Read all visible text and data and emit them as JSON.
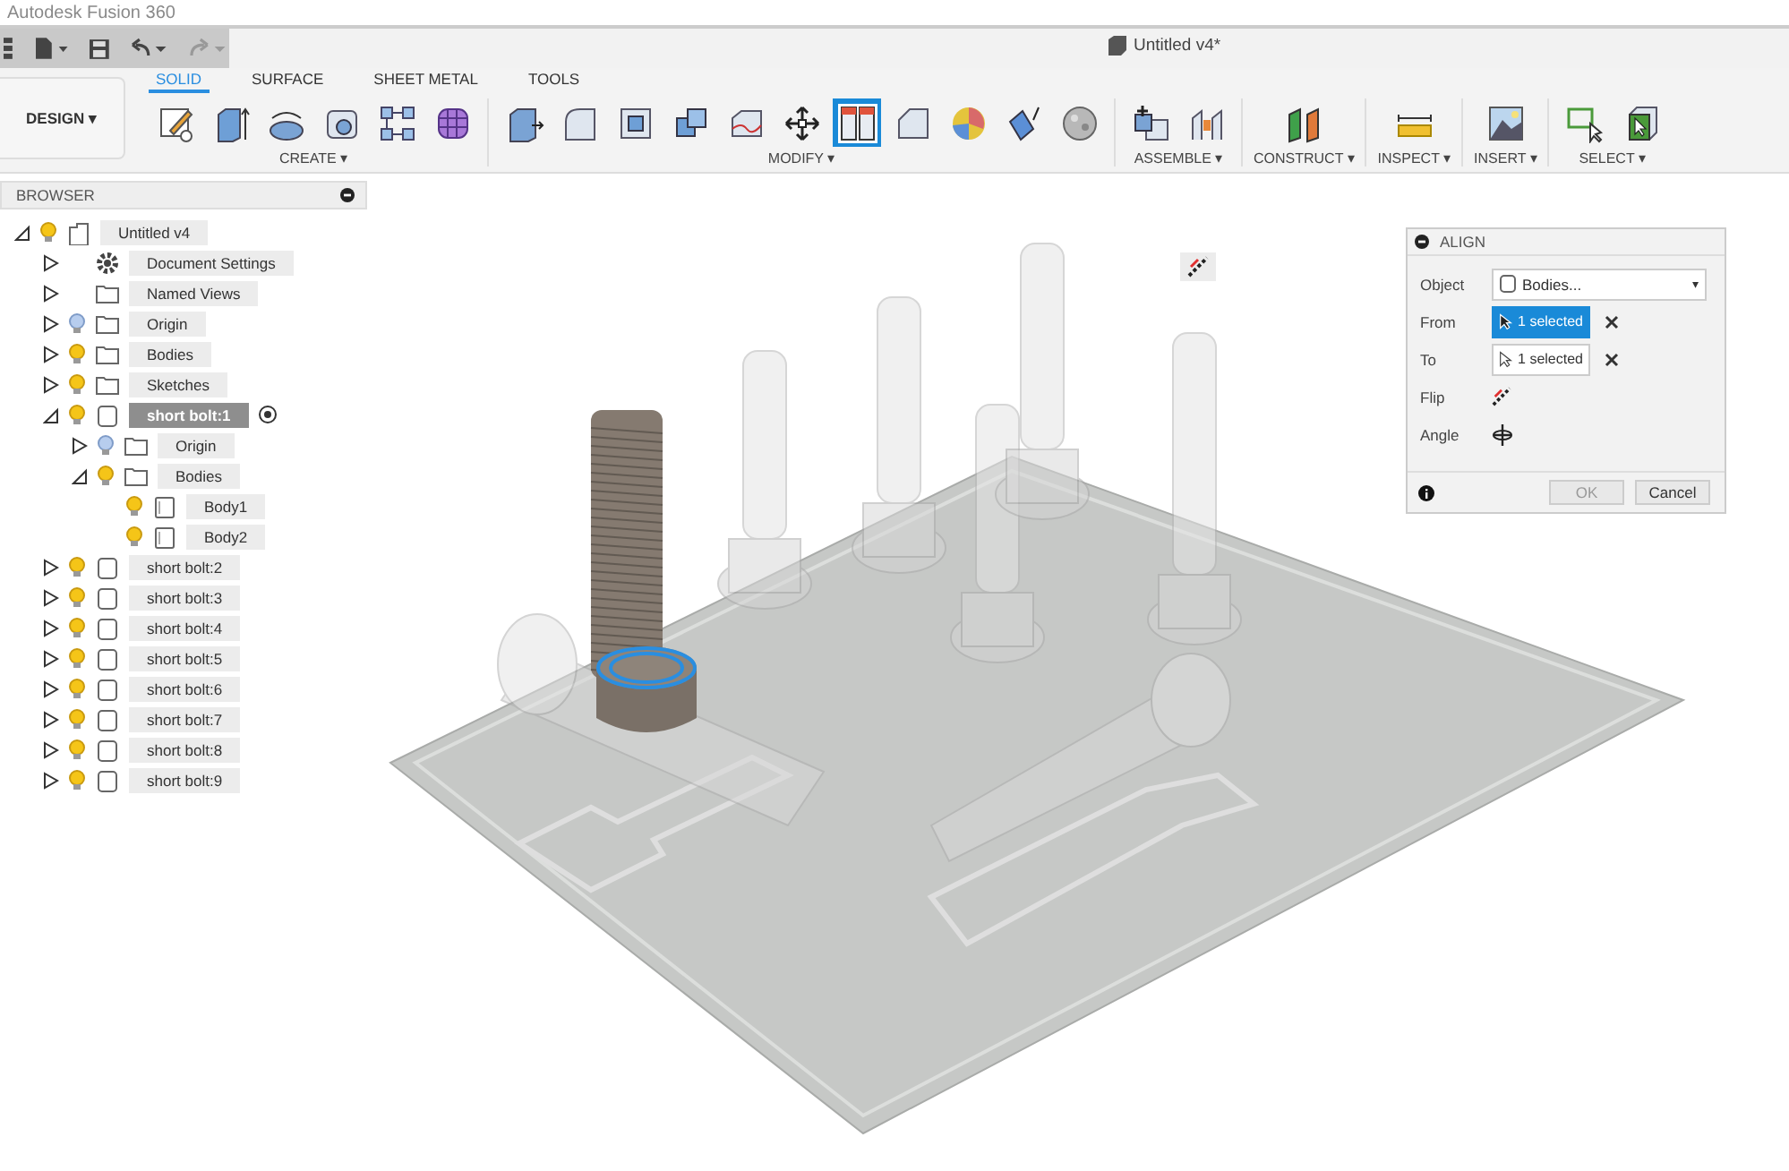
{
  "app_title": "Autodesk Fusion 360",
  "document_tab": {
    "title": "Untitled v4*"
  },
  "workspace": {
    "label": "DESIGN",
    "caret": "▾"
  },
  "tabs": [
    {
      "label": "SOLID",
      "selected": true
    },
    {
      "label": "SURFACE",
      "selected": false
    },
    {
      "label": "SHEET METAL",
      "selected": false
    },
    {
      "label": "TOOLS",
      "selected": false
    }
  ],
  "groups": [
    {
      "label": "CREATE ▾",
      "tools": [
        {
          "kind": "sketch",
          "active": false
        },
        {
          "kind": "extrude",
          "active": false
        },
        {
          "kind": "revolve",
          "active": false
        },
        {
          "kind": "hole",
          "active": false
        },
        {
          "kind": "pattern",
          "active": false
        },
        {
          "kind": "form",
          "active": false
        }
      ]
    },
    {
      "label": "MODIFY ▾",
      "tools": [
        {
          "kind": "press",
          "active": false
        },
        {
          "kind": "fillet",
          "active": false
        },
        {
          "kind": "shell",
          "active": false
        },
        {
          "kind": "combine",
          "active": false
        },
        {
          "kind": "replace",
          "active": false
        },
        {
          "kind": "move",
          "active": false
        },
        {
          "kind": "align",
          "active": true
        },
        {
          "kind": "chamfer",
          "active": false
        },
        {
          "kind": "appearance",
          "active": false
        },
        {
          "kind": "draft",
          "active": false
        },
        {
          "kind": "material",
          "active": false
        }
      ]
    },
    {
      "label": "ASSEMBLE ▾",
      "tools": [
        {
          "kind": "component",
          "active": false
        },
        {
          "kind": "joint",
          "active": false
        }
      ]
    },
    {
      "label": "CONSTRUCT ▾",
      "tools": [
        {
          "kind": "plane",
          "active": false
        }
      ]
    },
    {
      "label": "INSPECT ▾",
      "tools": [
        {
          "kind": "measure",
          "active": false
        }
      ]
    },
    {
      "label": "INSERT ▾",
      "tools": [
        {
          "kind": "image",
          "active": false
        }
      ]
    },
    {
      "label": "SELECT ▾",
      "tools": [
        {
          "kind": "window",
          "active": false
        },
        {
          "kind": "select",
          "active": false
        }
      ]
    }
  ],
  "browser": {
    "title": "BROWSER"
  },
  "tree": [
    {
      "label": "Untitled v4",
      "kind": "document",
      "visible": true,
      "expanded": true,
      "selected": false,
      "children": [
        {
          "label": "Document Settings",
          "kind": "settings",
          "expanded": false,
          "selected": false
        },
        {
          "label": "Named Views",
          "kind": "folder",
          "expanded": false,
          "selected": false
        },
        {
          "label": "Origin",
          "kind": "folder",
          "visible": false,
          "expanded": false,
          "selected": false
        },
        {
          "label": "Bodies",
          "kind": "folder",
          "visible": true,
          "expanded": false,
          "selected": false
        },
        {
          "label": "Sketches",
          "kind": "folder",
          "visible": true,
          "expanded": false,
          "selected": false
        },
        {
          "label": "short bolt:1",
          "kind": "component",
          "visible": true,
          "expanded": true,
          "selected": true,
          "active": true,
          "children": [
            {
              "label": "Origin",
              "kind": "folder",
              "visible": false,
              "expanded": false,
              "selected": false
            },
            {
              "label": "Bodies",
              "kind": "folder",
              "visible": true,
              "expanded": true,
              "selected": false,
              "children": [
                {
                  "label": "Body1",
                  "kind": "body",
                  "visible": true,
                  "selected": false
                },
                {
                  "label": "Body2",
                  "kind": "body",
                  "visible": true,
                  "selected": false
                }
              ]
            }
          ]
        },
        {
          "label": "short bolt:2",
          "kind": "component",
          "visible": true,
          "expanded": false,
          "selected": false
        },
        {
          "label": "short bolt:3",
          "kind": "component",
          "visible": true,
          "expanded": false,
          "selected": false
        },
        {
          "label": "short bolt:4",
          "kind": "component",
          "visible": true,
          "expanded": false,
          "selected": false
        },
        {
          "label": "short bolt:5",
          "kind": "component",
          "visible": true,
          "expanded": false,
          "selected": false
        },
        {
          "label": "short bolt:6",
          "kind": "component",
          "visible": true,
          "expanded": false,
          "selected": false
        },
        {
          "label": "short bolt:7",
          "kind": "component",
          "visible": true,
          "expanded": false,
          "selected": false
        },
        {
          "label": "short bolt:8",
          "kind": "component",
          "visible": true,
          "expanded": false,
          "selected": false
        },
        {
          "label": "short bolt:9",
          "kind": "component",
          "visible": true,
          "expanded": false,
          "selected": false
        }
      ]
    }
  ],
  "align_dialog": {
    "title": "ALIGN",
    "rows": [
      {
        "kind": "dropdown",
        "label": "Object",
        "value": "Bodies...",
        "caret": "▾"
      },
      {
        "kind": "selection",
        "label": "From",
        "value": "1 selected",
        "selected": true
      },
      {
        "kind": "selection",
        "label": "To",
        "value": "1 selected",
        "selected": false
      },
      {
        "kind": "flip",
        "label": "Flip"
      },
      {
        "kind": "angle",
        "label": "Angle"
      }
    ],
    "buttons": [
      {
        "label": "OK",
        "disabled": true
      },
      {
        "label": "Cancel",
        "disabled": false
      }
    ]
  }
}
